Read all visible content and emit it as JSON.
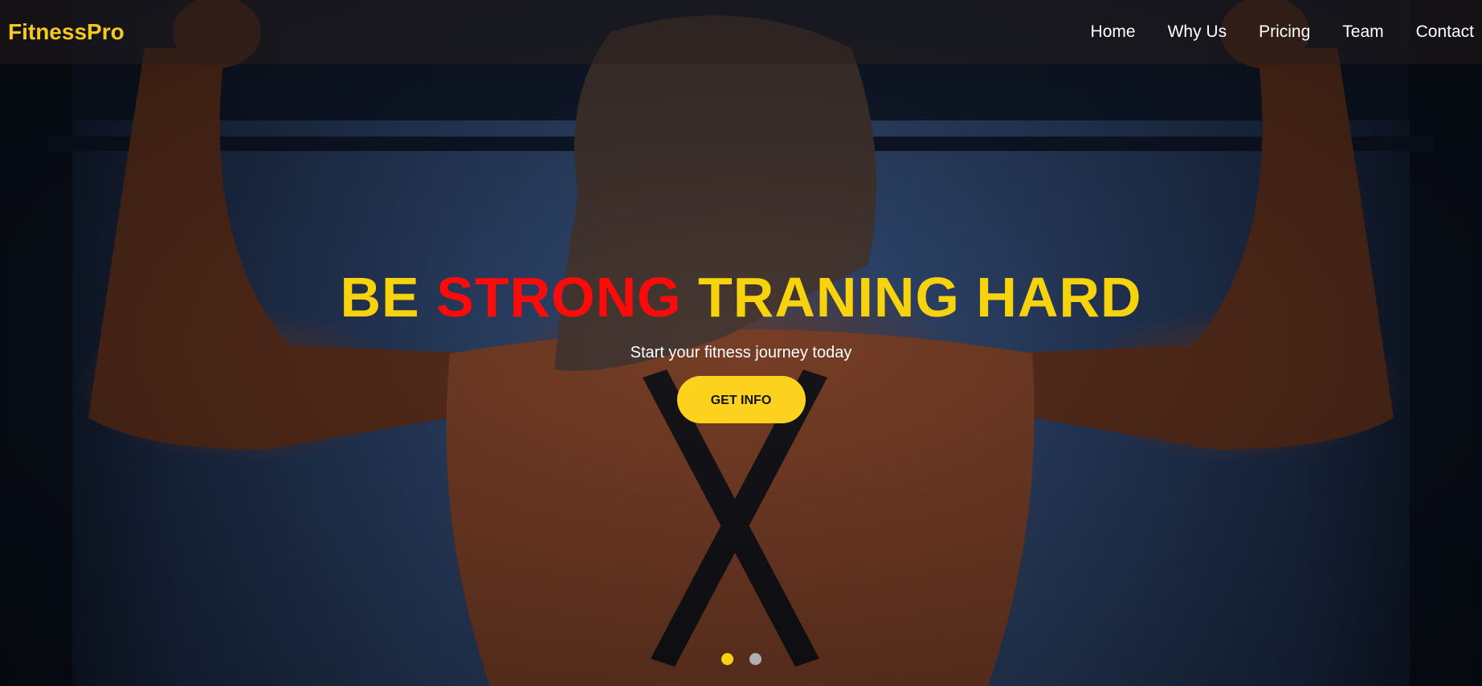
{
  "brand": "FitnessPro",
  "nav": [
    {
      "label": "Home"
    },
    {
      "label": "Why Us"
    },
    {
      "label": "Pricing"
    },
    {
      "label": "Team"
    },
    {
      "label": "Contact"
    }
  ],
  "hero": {
    "headline_part1": "BE ",
    "headline_accent": "STRONG",
    "headline_part2": " TRANING HARD",
    "subtitle": "Start your fitness journey today",
    "cta_label": "GET INFO",
    "slides": {
      "count": 2,
      "active_index": 0
    }
  },
  "colors": {
    "brand": "#f7c81d",
    "headline": "#f7d30d",
    "accent": "#ff0a0a",
    "cta": "#fcd21e"
  }
}
